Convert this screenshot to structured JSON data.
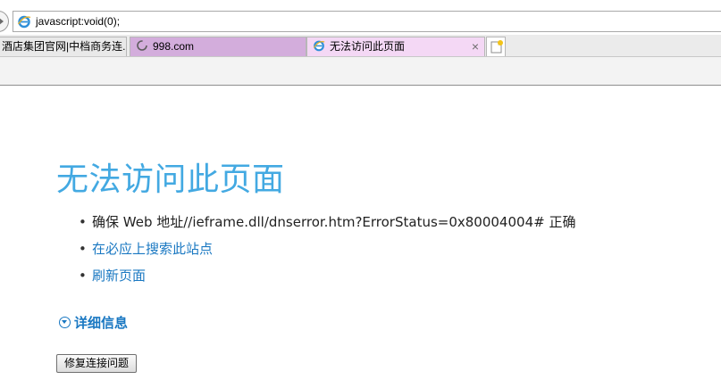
{
  "browser": {
    "address": {
      "url": "javascript:void(0);",
      "icon": "ie-icon"
    },
    "tabs": [
      {
        "label": "酒店集团官网|中档商务连...",
        "icon": "ie-icon"
      },
      {
        "label": "998.com",
        "icon": "loading-spinner-icon"
      },
      {
        "label": "无法访问此页面",
        "icon": "ie-icon",
        "active": true,
        "close": "×"
      }
    ],
    "new_tab_icon": "new-tab-icon",
    "colors": {
      "tab2": "#d3addc",
      "tab3_active": "#f4d8f5",
      "accent": "#43a9e2",
      "link": "#1a78c2"
    }
  },
  "page": {
    "title": "无法访问此页面",
    "bullet": "•",
    "suggestions": [
      {
        "text": "确保 Web 地址//ieframe.dll/dnserror.htm?ErrorStatus=0x80004004# 正确"
      },
      {
        "text": "在必应上搜索此站点",
        "link": true
      },
      {
        "text": "刷新页面",
        "link": true
      }
    ],
    "details_label": "详细信息",
    "fix_button_label": "修复连接问题"
  }
}
